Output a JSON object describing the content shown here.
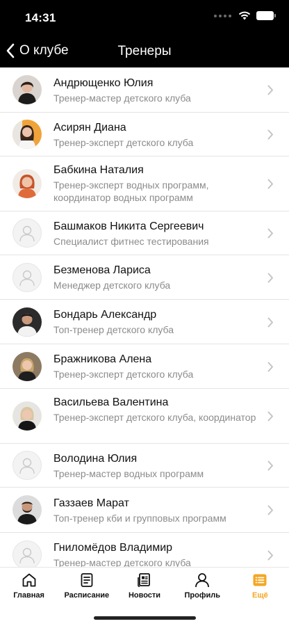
{
  "status_bar": {
    "time": "14:31"
  },
  "nav": {
    "back_label": "О клубе",
    "title": "Тренеры"
  },
  "trainers": [
    {
      "name": "Андрющенко Юлия",
      "role": "Тренер-мастер детского клуба",
      "avatar": "photo"
    },
    {
      "name": "Асирян Диана",
      "role": "Тренер-эксперт детского клуба",
      "avatar": "photo"
    },
    {
      "name": "Бабкина Наталия",
      "role": "Тренер-эксперт водных программ, координатор водных программ",
      "avatar": "photo"
    },
    {
      "name": "Башмаков Никита Сергеевич",
      "role": "Специалист фитнес тестирования",
      "avatar": "placeholder"
    },
    {
      "name": "Безменова Лариса",
      "role": "Менеджер детского клуба",
      "avatar": "placeholder"
    },
    {
      "name": "Бондарь Александр",
      "role": "Топ-тренер детского клуба",
      "avatar": "photo"
    },
    {
      "name": "Бражникова Алена",
      "role": "Тренер-эксперт детского клуба",
      "avatar": "photo"
    },
    {
      "name": "Васильева Валентина",
      "role": "Тренер-эксперт детского клуба, координатор",
      "avatar": "photo"
    },
    {
      "name": "Володина Юлия",
      "role": "Тренер-мастер водных программ",
      "avatar": "placeholder"
    },
    {
      "name": "Газзаев Марат",
      "role": "Топ-тренер кби и групповых программ",
      "avatar": "photo"
    },
    {
      "name": "Гниломёдов Владимир",
      "role": "Тренер-мастер детского клуба",
      "avatar": "placeholder"
    }
  ],
  "tabs": [
    {
      "label": "Главная",
      "icon": "home-icon"
    },
    {
      "label": "Расписание",
      "icon": "schedule-icon"
    },
    {
      "label": "Новости",
      "icon": "news-icon"
    },
    {
      "label": "Профиль",
      "icon": "profile-icon"
    },
    {
      "label": "Ещё",
      "icon": "more-icon",
      "active": true
    }
  ],
  "colors": {
    "accent": "#f5a623",
    "header_bg": "#000000",
    "secondary_text": "#8b8b8b"
  }
}
